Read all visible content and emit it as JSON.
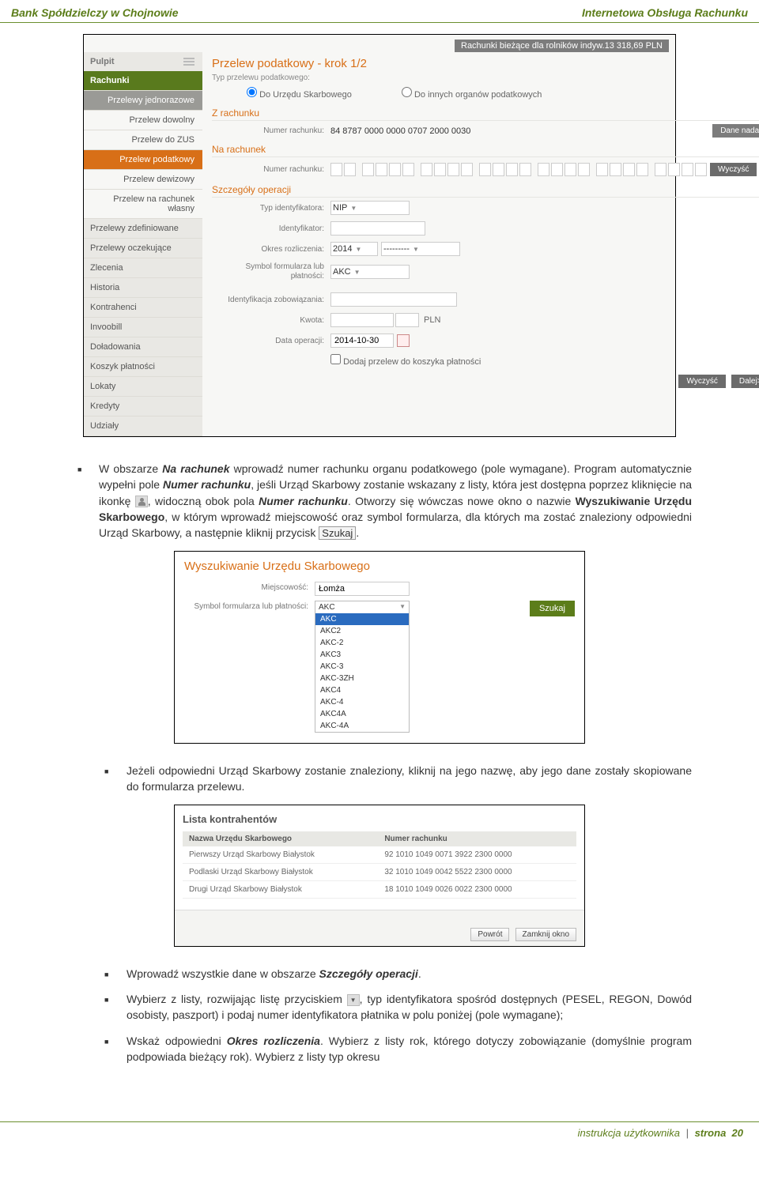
{
  "header": {
    "left": "Bank Spółdzielczy w Chojnowie",
    "right": "Internetowa Obsługa Rachunku"
  },
  "ss1": {
    "banner_label": "Rachunki bieżące dla rolników indyw.",
    "banner_value": "13 318,69 PLN",
    "side": {
      "pulpit": "Pulpit",
      "items": [
        "Rachunki",
        "Przelewy jednorazowe",
        "Przelew dowolny",
        "Przelew do ZUS",
        "Przelew podatkowy",
        "Przelew dewizowy",
        "Przelew na rachunek własny",
        "Przelewy zdefiniowane",
        "Przelewy oczekujące",
        "Zlecenia",
        "Historia",
        "Kontrahenci",
        "Invoobill",
        "Doładowania",
        "Koszyk płatności",
        "Lokaty",
        "Kredyty",
        "Udziały"
      ]
    },
    "main": {
      "title": "Przelew podatkowy - krok 1/2",
      "typ_label": "Typ przelewu podatkowego:",
      "radio1": "Do Urzędu Skarbowego",
      "radio2": "Do innych organów podatkowych",
      "z_rachunku": "Z rachunku",
      "numer_rachunku_label": "Numer rachunku:",
      "numer_rachunku_value": "84 8787 0000 0000 0707 2000 0030",
      "dane_nadawcy": "Dane nadawcy",
      "na_rachunek": "Na rachunek",
      "wyczysc": "Wyczyść",
      "szczegoly": "Szczegóły operacji",
      "typ_id_label": "Typ identyfikatora:",
      "typ_id_value": "NIP",
      "identyfikator_label": "Identyfikator:",
      "okres_label": "Okres rozliczenia:",
      "okres_year": "2014",
      "okres_dash": "---------",
      "symbol_label": "Symbol formularza lub płatności:",
      "symbol_value": "AKC",
      "ident_zob": "Identyfikacja zobowiązania:",
      "kwota_label": "Kwota:",
      "kwota_currency": "PLN",
      "data_label": "Data operacji:",
      "data_value": "2014-10-30",
      "dodaj_koszyk": "Dodaj przelew do koszyka płatności",
      "dalej": "Dalej>>"
    }
  },
  "body": {
    "p1_a": "W obszarze ",
    "p1_b": "Na rachunek",
    "p1_c": " wprowadź numer rachunku organu podatkowego (pole wymagane). Program automatycznie wypełni pole ",
    "p1_d": "Numer rachunku",
    "p1_e": ", jeśli Urząd Skarbowy zostanie wskazany z listy, która jest dostępna poprzez kliknięcie na ikonkę ",
    "p1_f": ", widoczną obok pola ",
    "p1_g": "Numer rachunku",
    "p1_h": ". Otworzy się wówczas nowe okno o nazwie ",
    "p1_i": "Wyszukiwanie Urzędu Skarbowego",
    "p1_j": ", w którym wprowadź miejscowość oraz symbol formularza, dla których ma zostać znaleziony odpowiedni Urząd Skarbowy, a następnie kliknij przycisk ",
    "p1_k": "Szukaj",
    "p1_l": ".",
    "p2": "Jeżeli odpowiedni Urząd Skarbowy zostanie znaleziony, kliknij na jego nazwę, aby jego dane zostały skopiowane do formularza przelewu.",
    "p3_a": "Wprowadź wszystkie dane w obszarze ",
    "p3_b": "Szczegóły operacji",
    "p3_c": ".",
    "p4_a": "Wybierz z listy, rozwijając listę przyciskiem ",
    "p4_b": ", typ identyfikatora spośród dostępnych (PESEL, REGON, Dowód osobisty, paszport) i podaj numer identyfikatora płatnika w polu poniżej (pole wymagane);",
    "p5_a": "Wskaż odpowiedni ",
    "p5_b": "Okres rozliczenia",
    "p5_c": ". Wybierz z listy rok, którego dotyczy zobowiązanie (domyślnie program podpowiada bieżący rok). Wybierz z listy typ okresu"
  },
  "ss2": {
    "title": "Wyszukiwanie Urzędu Skarbowego",
    "miejscowosc_label": "Miejscowość:",
    "miejscowosc_value": "Łomża",
    "symbol_label": "Symbol formularza lub płatności:",
    "sel_value": "AKC",
    "options": [
      "AKC",
      "AKC2",
      "AKC-2",
      "AKC3",
      "AKC-3",
      "AKC-3ZH",
      "AKC4",
      "AKC-4",
      "AKC4A",
      "AKC-4A"
    ],
    "szukaj": "Szukaj"
  },
  "ss3": {
    "title": "Lista kontrahentów",
    "col1": "Nazwa Urzędu Skarbowego",
    "col2": "Numer rachunku",
    "rows": [
      {
        "name": "Pierwszy Urząd Skarbowy Białystok",
        "acc": "92 1010 1049 0071 3922 2300 0000"
      },
      {
        "name": "Podlaski Urząd Skarbowy Białystok",
        "acc": "32 1010 1049 0042 5522 2300 0000"
      },
      {
        "name": "Drugi Urząd Skarbowy Białystok",
        "acc": "18 1010 1049 0026 0022 2300 0000"
      }
    ],
    "powrot": "Powrót",
    "zamknij": "Zamknij okno"
  },
  "footer": {
    "left": "instrukcja użytkownika",
    "page_label": "strona",
    "page_num": "20"
  }
}
